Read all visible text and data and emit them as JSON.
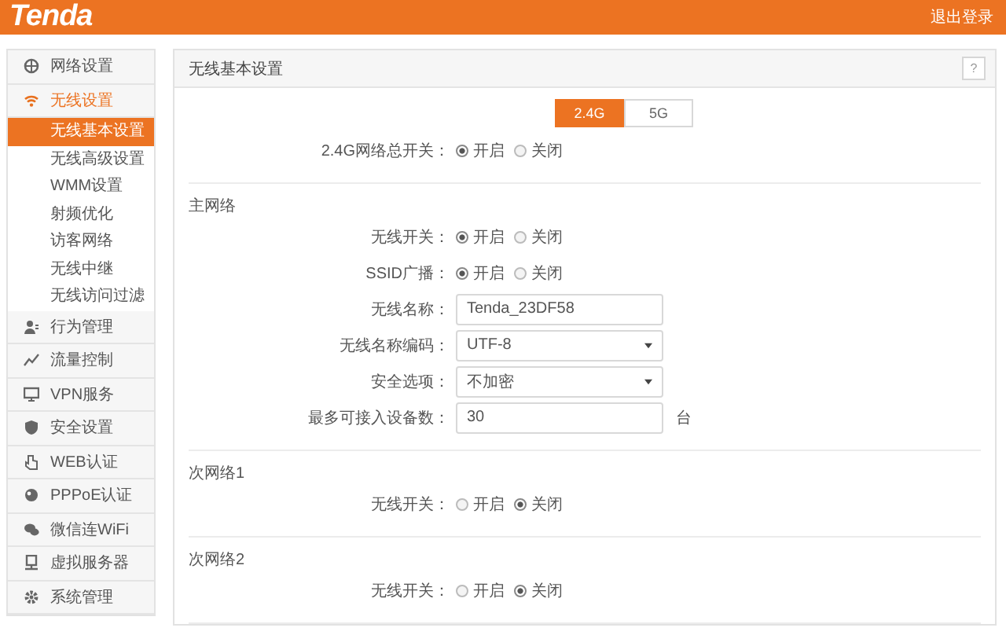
{
  "header": {
    "logo": "Tenda",
    "logout": "退出登录"
  },
  "sidebar": {
    "items": [
      {
        "label": "网络设置",
        "expanded": false
      },
      {
        "label": "无线设置",
        "expanded": true,
        "children": [
          {
            "label": "无线基本设置",
            "selected": true
          },
          {
            "label": "无线高级设置",
            "selected": false
          },
          {
            "label": "WMM设置",
            "selected": false
          },
          {
            "label": "射频优化",
            "selected": false
          },
          {
            "label": "访客网络",
            "selected": false
          },
          {
            "label": "无线中继",
            "selected": false
          },
          {
            "label": "无线访问过滤",
            "selected": false
          }
        ]
      },
      {
        "label": "行为管理",
        "expanded": false
      },
      {
        "label": "流量控制",
        "expanded": false
      },
      {
        "label": "VPN服务",
        "expanded": false
      },
      {
        "label": "安全设置",
        "expanded": false
      },
      {
        "label": "WEB认证",
        "expanded": false
      },
      {
        "label": "PPPoE认证",
        "expanded": false
      },
      {
        "label": "微信连WiFi",
        "expanded": false
      },
      {
        "label": "虚拟服务器",
        "expanded": false
      },
      {
        "label": "系统管理",
        "expanded": false
      }
    ]
  },
  "panel": {
    "title": "无线基本设置",
    "help": "?",
    "band_tabs": [
      {
        "label": "2.4G",
        "selected": true
      },
      {
        "label": "5G",
        "selected": false
      }
    ],
    "master_switch": {
      "label": "2.4G网络总开关：",
      "options": [
        {
          "label": "开启",
          "selected": true
        },
        {
          "label": "关闭",
          "selected": false
        }
      ]
    },
    "sections": [
      {
        "title": "主网络",
        "rows": [
          {
            "kind": "radio",
            "label": "无线开关：",
            "options": [
              {
                "label": "开启",
                "selected": true
              },
              {
                "label": "关闭",
                "selected": false
              }
            ]
          },
          {
            "kind": "radio",
            "label": "SSID广播：",
            "options": [
              {
                "label": "开启",
                "selected": true
              },
              {
                "label": "关闭",
                "selected": false
              }
            ]
          },
          {
            "kind": "text",
            "label": "无线名称：",
            "value": "Tenda_23DF58"
          },
          {
            "kind": "select",
            "label": "无线名称编码：",
            "value": "UTF-8"
          },
          {
            "kind": "select",
            "label": "安全选项：",
            "value": "不加密"
          },
          {
            "kind": "text",
            "label": "最多可接入设备数：",
            "value": "30",
            "unit": "台"
          }
        ]
      },
      {
        "title": "次网络1",
        "rows": [
          {
            "kind": "radio",
            "label": "无线开关：",
            "options": [
              {
                "label": "开启",
                "selected": false
              },
              {
                "label": "关闭",
                "selected": true
              }
            ]
          }
        ]
      },
      {
        "title": "次网络2",
        "rows": [
          {
            "kind": "radio",
            "label": "无线开关：",
            "options": [
              {
                "label": "开启",
                "selected": false
              },
              {
                "label": "关闭",
                "selected": true
              }
            ]
          }
        ]
      }
    ]
  }
}
